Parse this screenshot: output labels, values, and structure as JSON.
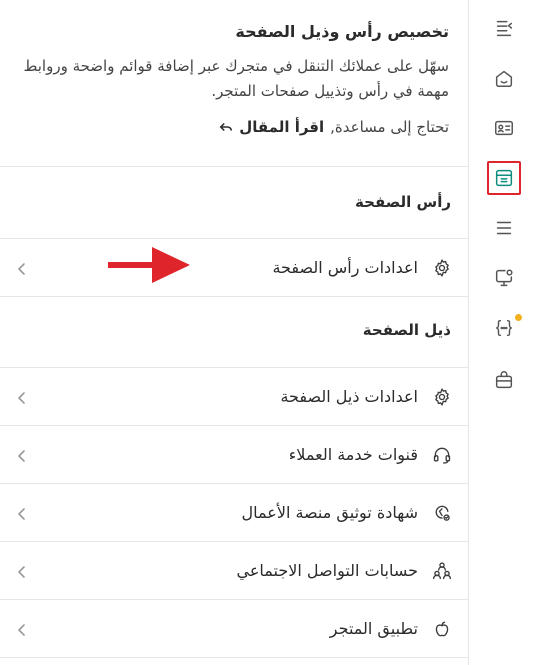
{
  "intro": {
    "title": "تخصيص رأس وذيل الصفحة",
    "description": "سهّل على عملائك التنقل في متجرك عبر إضافة قوائم واضحة وروابط مهمة في رأس وتذييل صفحات المتجر.",
    "help_prefix": "تحتاج إلى مساعدة,",
    "help_link": "اقرأ المقال"
  },
  "header_section": {
    "title": "رأس الصفحة",
    "items": [
      {
        "label": "اعدادات رأس الصفحة",
        "icon": "gear-icon"
      }
    ]
  },
  "footer_section": {
    "title": "ذيل الصفحة",
    "items": [
      {
        "label": "اعدادات ذيل الصفحة",
        "icon": "gear-icon"
      },
      {
        "label": "قنوات خدمة العملاء",
        "icon": "headset-icon"
      },
      {
        "label": "شهادة توثيق منصة الأعمال",
        "icon": "certificate-icon"
      },
      {
        "label": "حسابات التواصل الاجتماعي",
        "icon": "people-icon"
      },
      {
        "label": "تطبيق المتجر",
        "icon": "apple-icon"
      }
    ]
  },
  "rail": {
    "items": [
      {
        "icon": "collapse-menu-icon"
      },
      {
        "icon": "home-icon"
      },
      {
        "icon": "id-card-icon"
      },
      {
        "icon": "layout-icon",
        "active": true
      },
      {
        "icon": "menu-lines-icon"
      },
      {
        "icon": "display-settings-icon"
      },
      {
        "icon": "code-braces-icon",
        "badge": true
      },
      {
        "icon": "bag-icon"
      }
    ]
  },
  "colors": {
    "accent": "#0f8c80",
    "highlight": "#e0242c",
    "badge": "#f2b01e",
    "border": "#e6e6e6"
  }
}
